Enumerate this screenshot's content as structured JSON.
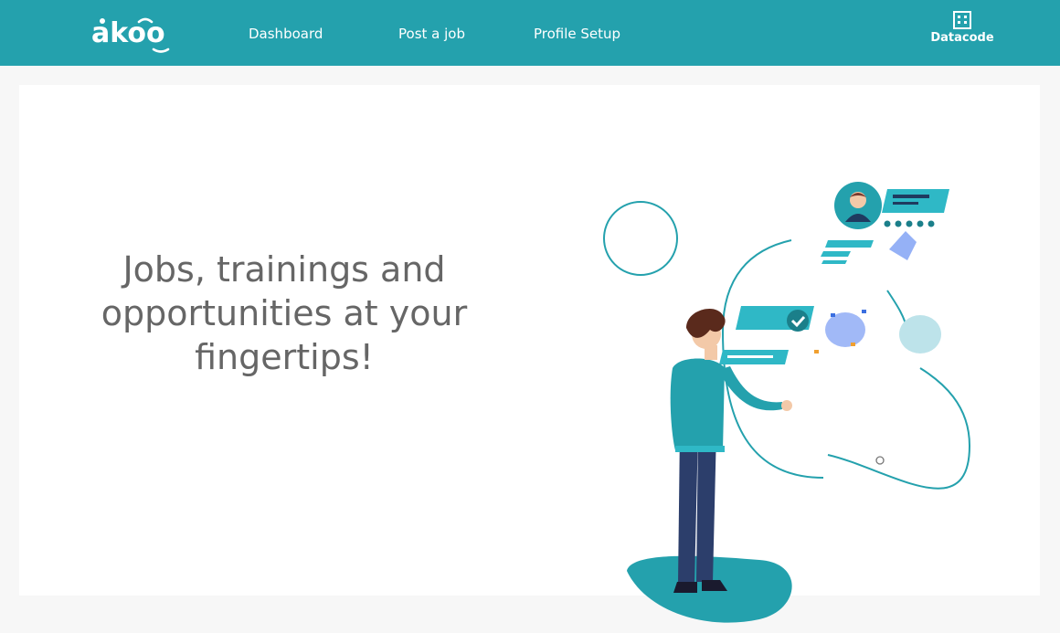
{
  "brand": {
    "logo_text": "akoo",
    "logo_color": "#ffffff"
  },
  "nav": {
    "items": [
      {
        "label": "Dashboard"
      },
      {
        "label": "Post a job"
      },
      {
        "label": "Profile Setup"
      }
    ]
  },
  "organization": {
    "name": "Datacode",
    "icon": "building-icon"
  },
  "hero": {
    "headline": "Jobs, trainings and opportunities at your fingertips!",
    "illustration": "person-touching-screen-illustration"
  },
  "colors": {
    "header_bg": "#24a1ad",
    "accent": "#2fb8c6",
    "page_bg": "#f7f7f7",
    "card_bg": "#ffffff",
    "headline_text": "#666666"
  }
}
